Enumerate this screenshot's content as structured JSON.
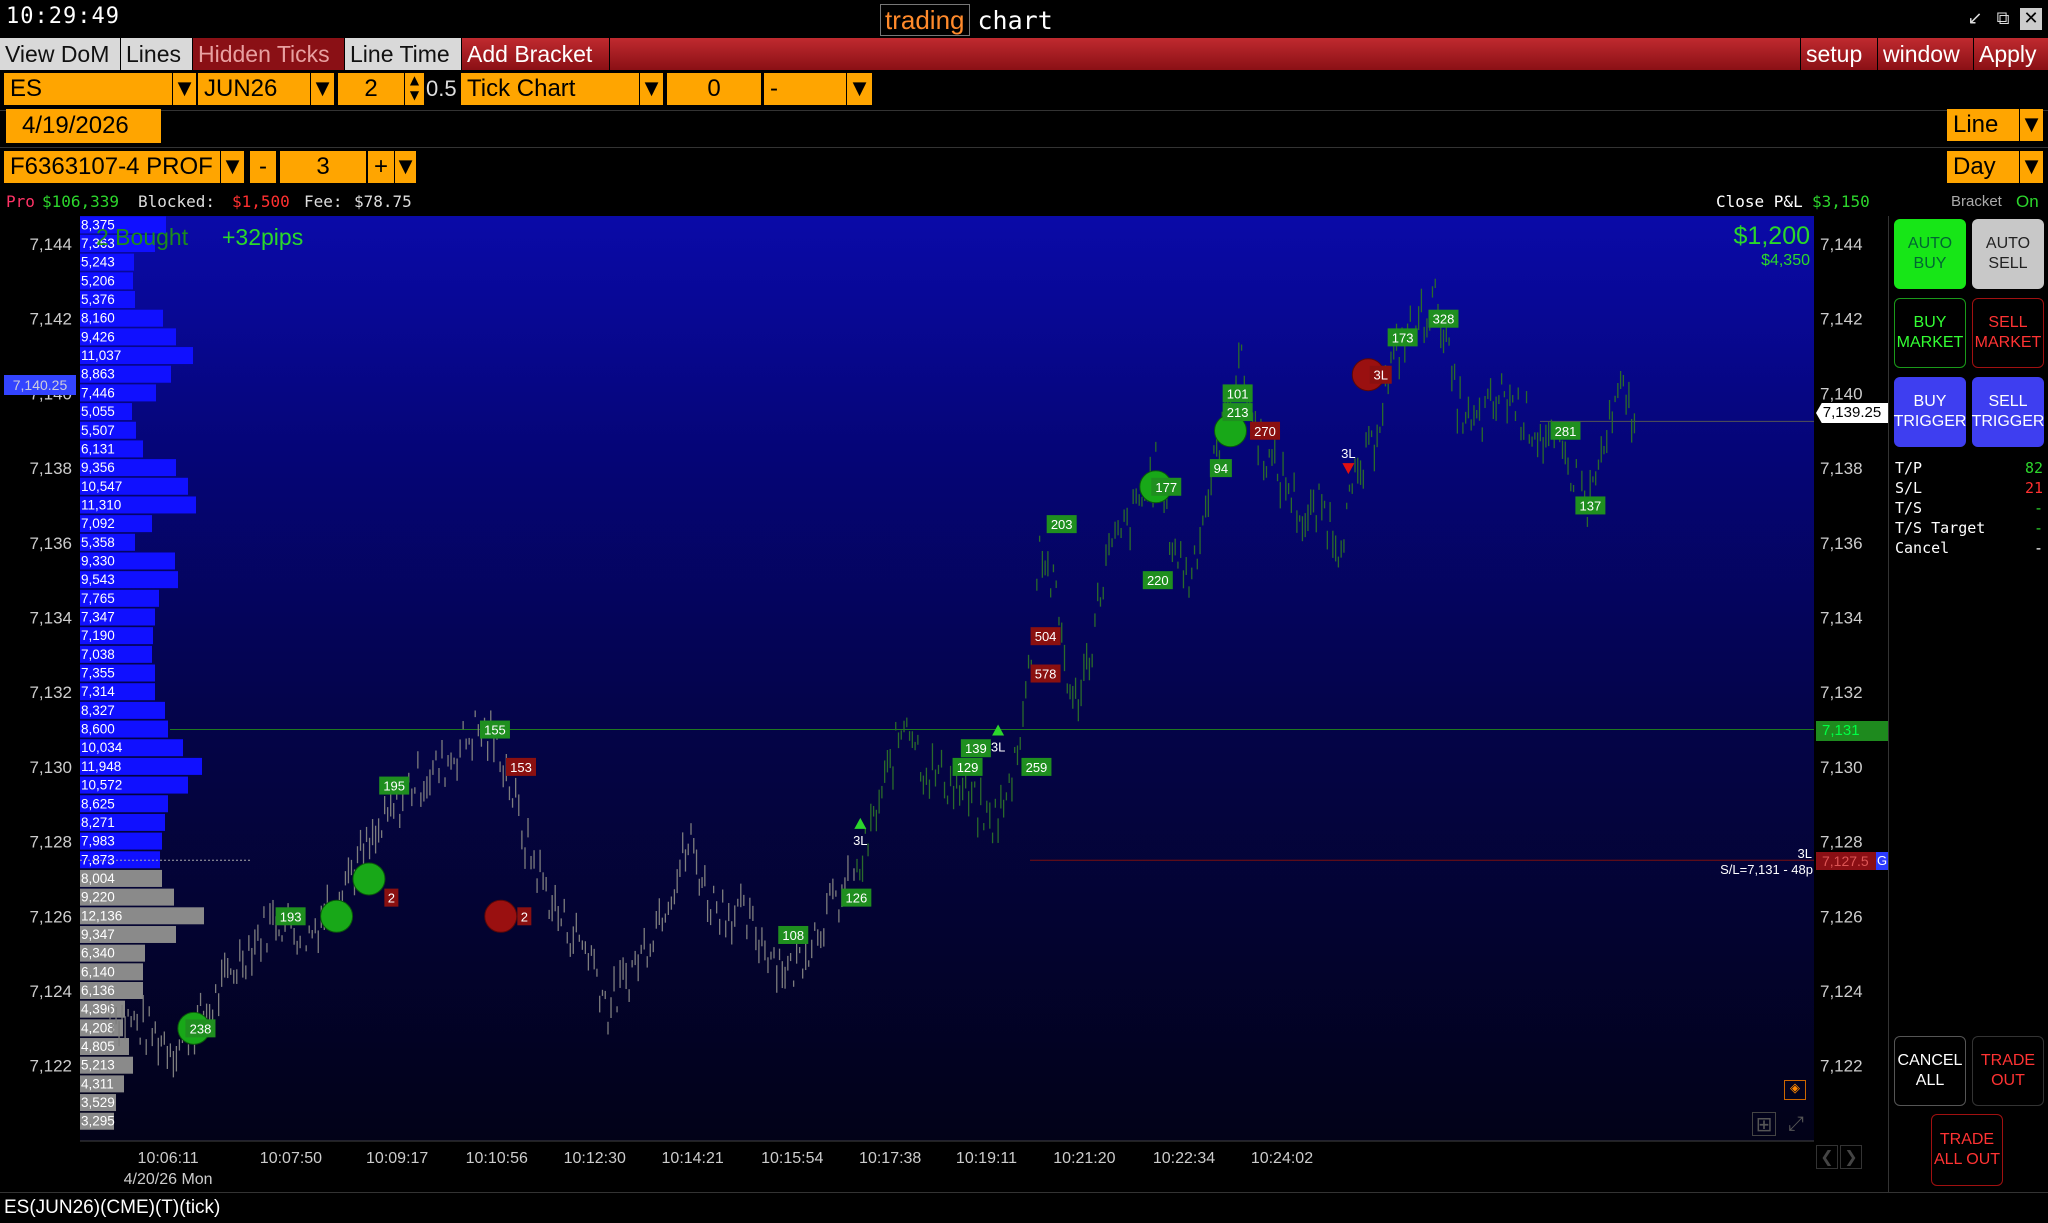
{
  "clock": "10:29:49",
  "title": {
    "app": "trading",
    "name": "chart"
  },
  "toolbar": {
    "view_dom": "View DoM",
    "lines": "Lines",
    "hidden_ticks": "Hidden Ticks",
    "line_time": "Line Time",
    "add_bracket": "Add Bracket",
    "setup": "setup",
    "window": "window",
    "apply": "Apply"
  },
  "controls": {
    "symbol": "ES",
    "month": "JUN26",
    "qty": "2",
    "tick_size": "0.5",
    "chart_type": "Tick Chart",
    "offset": "0",
    "dash": "-",
    "date": "4/19/2026",
    "style": "Line",
    "period": "Day",
    "account": "F6363107-4 PROF",
    "minus": "-",
    "contracts": "3",
    "plus": "+"
  },
  "info": {
    "pro_label": "Pro",
    "pro_value": "$106,339",
    "blocked_label": "Blocked:",
    "blocked_value": "$1,500",
    "fee_label": "Fee:",
    "fee_value": "$78.75",
    "close_pl_label": "Close P&L",
    "close_pl_value": "$3,150",
    "bracket_label": "Bracket",
    "bracket_value": "On"
  },
  "overlay": {
    "position": "2 Bought",
    "pips": "+32pips",
    "pl": "$1,200",
    "pl2": "$4,350",
    "sl_text": "S/L=7,131 - 48p",
    "sl_3l": "3L"
  },
  "price_tags": {
    "current": "7,139.25",
    "target": "7,131",
    "stop": "7,127.5",
    "left_marker": "7,140.25",
    "stop_flag": "G"
  },
  "chart_data": {
    "type": "table",
    "instrument": "ES(JUN26)(CME)(T)(tick)",
    "x_ticks": [
      "10:06:11",
      "10:07:50",
      "10:09:17",
      "10:10:56",
      "10:12:30",
      "10:14:21",
      "10:15:54",
      "10:17:38",
      "10:19:11",
      "10:21:20",
      "10:22:34",
      "10:24:02"
    ],
    "x_date": "4/20/26 Mon",
    "y_ticks": [
      7144,
      7142,
      7140,
      7138,
      7136,
      7134,
      7132,
      7130,
      7128,
      7126,
      7124,
      7122
    ],
    "y_tick_labels": [
      "7,144",
      "7,142",
      "7,140",
      "7,138",
      "7,136",
      "7,134",
      "7,132",
      "7,130",
      "7,128",
      "7,126",
      "7,124",
      "7,122"
    ],
    "ylim": [
      7120.5,
      7145
    ],
    "volume_profile": [
      {
        "price": 7144.5,
        "vol": "8,375"
      },
      {
        "price": 7144,
        "vol": "7,363"
      },
      {
        "price": 7143.5,
        "vol": "5,243"
      },
      {
        "price": 7143,
        "vol": "5,206"
      },
      {
        "price": 7142.5,
        "vol": "5,376"
      },
      {
        "price": 7142,
        "vol": "8,160"
      },
      {
        "price": 7141.5,
        "vol": "9,426"
      },
      {
        "price": 7141,
        "vol": "11,037"
      },
      {
        "price": 7140.5,
        "vol": "8,863"
      },
      {
        "price": 7140,
        "vol": "7,446"
      },
      {
        "price": 7139.5,
        "vol": "5,055"
      },
      {
        "price": 7139,
        "vol": "5,507"
      },
      {
        "price": 7138.5,
        "vol": "6,131"
      },
      {
        "price": 7138,
        "vol": "9,356"
      },
      {
        "price": 7137.5,
        "vol": "10,547"
      },
      {
        "price": 7137,
        "vol": "11,310"
      },
      {
        "price": 7136.5,
        "vol": "7,092"
      },
      {
        "price": 7136,
        "vol": "5,358"
      },
      {
        "price": 7135.5,
        "vol": "9,330"
      },
      {
        "price": 7135,
        "vol": "9,543"
      },
      {
        "price": 7134.5,
        "vol": "7,765"
      },
      {
        "price": 7134,
        "vol": "7,347"
      },
      {
        "price": 7133.5,
        "vol": "7,190"
      },
      {
        "price": 7133,
        "vol": "7,038"
      },
      {
        "price": 7132.5,
        "vol": "7,355"
      },
      {
        "price": 7132,
        "vol": "7,314"
      },
      {
        "price": 7131.5,
        "vol": "8,327"
      },
      {
        "price": 7131,
        "vol": "8,600"
      },
      {
        "price": 7130.5,
        "vol": "10,034"
      },
      {
        "price": 7130,
        "vol": "11,948"
      },
      {
        "price": 7129.5,
        "vol": "10,572"
      },
      {
        "price": 7129,
        "vol": "8,625"
      },
      {
        "price": 7128.5,
        "vol": "8,271"
      },
      {
        "price": 7128,
        "vol": "7,983"
      },
      {
        "price": 7127.5,
        "vol": "7,873"
      },
      {
        "price": 7127,
        "vol": "8,004"
      },
      {
        "price": 7126.5,
        "vol": "9,220"
      },
      {
        "price": 7126,
        "vol": "12,136"
      },
      {
        "price": 7125.5,
        "vol": "9,347"
      },
      {
        "price": 7125,
        "vol": "6,340"
      },
      {
        "price": 7124.5,
        "vol": "6,140"
      },
      {
        "price": 7124,
        "vol": "6,136"
      },
      {
        "price": 7123.5,
        "vol": "4,396"
      },
      {
        "price": 7123,
        "vol": "4,208"
      },
      {
        "price": 7122.5,
        "vol": "4,805"
      },
      {
        "price": 7122,
        "vol": "5,213"
      },
      {
        "price": 7121.5,
        "vol": "4,311"
      },
      {
        "price": 7121,
        "vol": "3,529"
      },
      {
        "price": 7120.5,
        "vol": "3,295"
      }
    ],
    "trade_labels": [
      {
        "t": 0.0545,
        "price": 7123,
        "text": "238",
        "color": "green"
      },
      {
        "t": 0.1088,
        "price": 7126,
        "text": "193",
        "color": "green"
      },
      {
        "t": 0.1695,
        "price": 7126.5,
        "text": "2",
        "color": "red"
      },
      {
        "t": 0.1712,
        "price": 7129.5,
        "text": "195",
        "color": "green"
      },
      {
        "t": 0.2319,
        "price": 7131,
        "text": "155",
        "color": "green"
      },
      {
        "t": 0.2476,
        "price": 7130,
        "text": "153",
        "color": "red"
      },
      {
        "t": 0.2496,
        "price": 7126,
        "text": "2",
        "color": "red"
      },
      {
        "t": 0.4116,
        "price": 7125.5,
        "text": "108",
        "color": "green"
      },
      {
        "t": 0.4496,
        "price": 7126.5,
        "text": "126",
        "color": "green"
      },
      {
        "t": 0.5166,
        "price": 7130,
        "text": "129",
        "color": "green"
      },
      {
        "t": 0.5216,
        "price": 7130.5,
        "text": "139",
        "color": "green"
      },
      {
        "t": 0.5581,
        "price": 7130,
        "text": "259",
        "color": "green"
      },
      {
        "t": 0.5636,
        "price": 7132.5,
        "text": "578",
        "color": "red"
      },
      {
        "t": 0.5636,
        "price": 7133.5,
        "text": "504",
        "color": "red"
      },
      {
        "t": 0.5733,
        "price": 7136.5,
        "text": "203",
        "color": "green"
      },
      {
        "t": 0.6312,
        "price": 7135,
        "text": "220",
        "color": "green"
      },
      {
        "t": 0.6363,
        "price": 7137.5,
        "text": "177",
        "color": "green"
      },
      {
        "t": 0.6692,
        "price": 7138,
        "text": "94",
        "color": "green"
      },
      {
        "t": 0.6793,
        "price": 7140,
        "text": "101",
        "color": "green"
      },
      {
        "t": 0.6793,
        "price": 7139.5,
        "text": "213",
        "color": "green"
      },
      {
        "t": 0.6958,
        "price": 7139,
        "text": "270",
        "color": "red"
      },
      {
        "t": 0.7655,
        "price": 7140.5,
        "text": "3L",
        "color": "red"
      },
      {
        "t": 0.7787,
        "price": 7141.5,
        "text": "173",
        "color": "green"
      },
      {
        "t": 0.8033,
        "price": 7142,
        "text": "328",
        "color": "green"
      },
      {
        "t": 0.8768,
        "price": 7139,
        "text": "281",
        "color": "green"
      },
      {
        "t": 0.8918,
        "price": 7137,
        "text": "137",
        "color": "green"
      }
    ],
    "entry_markers": [
      {
        "t": 0.0505,
        "price": 7123,
        "side": "buy"
      },
      {
        "t": 0.1365,
        "price": 7126,
        "side": "buy"
      },
      {
        "t": 0.156,
        "price": 7127,
        "side": "buy"
      },
      {
        "t": 0.2354,
        "price": 7126,
        "side": "sell"
      },
      {
        "t": 0.63,
        "price": 7137.5,
        "side": "buy"
      },
      {
        "t": 0.675,
        "price": 7139,
        "side": "buy"
      },
      {
        "t": 0.758,
        "price": 7140.5,
        "side": "sell"
      }
    ],
    "signal_arrows": [
      {
        "t": 0.452,
        "price": 7128.5,
        "dir": "up",
        "label": "3L"
      },
      {
        "t": 0.535,
        "price": 7131,
        "dir": "up",
        "label": "3L"
      },
      {
        "t": 0.746,
        "price": 7138,
        "dir": "down",
        "label": "3L"
      }
    ],
    "price_path": [
      [
        0.0,
        7123.5
      ],
      [
        0.04,
        7122.5
      ],
      [
        0.06,
        7123.5
      ],
      [
        0.08,
        7125
      ],
      [
        0.1,
        7126
      ],
      [
        0.12,
        7125.5
      ],
      [
        0.14,
        7127
      ],
      [
        0.16,
        7128
      ],
      [
        0.18,
        7129.5
      ],
      [
        0.2,
        7130
      ],
      [
        0.22,
        7131
      ],
      [
        0.235,
        7130.5
      ],
      [
        0.25,
        7128
      ],
      [
        0.27,
        7126
      ],
      [
        0.29,
        7125
      ],
      [
        0.3,
        7123.5
      ],
      [
        0.32,
        7125
      ],
      [
        0.34,
        7127
      ],
      [
        0.35,
        7128
      ],
      [
        0.36,
        7126.5
      ],
      [
        0.38,
        7126
      ],
      [
        0.4,
        7125
      ],
      [
        0.41,
        7124.5
      ],
      [
        0.43,
        7126
      ],
      [
        0.45,
        7127
      ],
      [
        0.46,
        7128.5
      ],
      [
        0.47,
        7130
      ],
      [
        0.48,
        7131.5
      ],
      [
        0.49,
        7130
      ],
      [
        0.51,
        7129.5
      ],
      [
        0.53,
        7128.5
      ],
      [
        0.54,
        7129
      ],
      [
        0.55,
        7131.5
      ],
      [
        0.555,
        7133
      ],
      [
        0.56,
        7136
      ],
      [
        0.57,
        7134.5
      ],
      [
        0.58,
        7131.5
      ],
      [
        0.59,
        7133
      ],
      [
        0.6,
        7135.5
      ],
      [
        0.62,
        7137
      ],
      [
        0.63,
        7138
      ],
      [
        0.64,
        7136
      ],
      [
        0.65,
        7135
      ],
      [
        0.66,
        7137
      ],
      [
        0.67,
        7139
      ],
      [
        0.68,
        7141
      ],
      [
        0.69,
        7139
      ],
      [
        0.7,
        7138
      ],
      [
        0.71,
        7137.5
      ],
      [
        0.72,
        7136.5
      ],
      [
        0.73,
        7137
      ],
      [
        0.74,
        7136
      ],
      [
        0.75,
        7137.5
      ],
      [
        0.76,
        7138.5
      ],
      [
        0.77,
        7140.5
      ],
      [
        0.78,
        7141.5
      ],
      [
        0.79,
        7142
      ],
      [
        0.8,
        7142.5
      ],
      [
        0.81,
        7140
      ],
      [
        0.82,
        7139
      ],
      [
        0.83,
        7139.5
      ],
      [
        0.84,
        7140
      ],
      [
        0.85,
        7139.5
      ],
      [
        0.86,
        7139
      ],
      [
        0.87,
        7138.5
      ],
      [
        0.88,
        7138
      ],
      [
        0.89,
        7137
      ],
      [
        0.9,
        7138.5
      ],
      [
        0.91,
        7140
      ],
      [
        0.92,
        7139.25
      ]
    ],
    "x_tick_t": [
      0.035,
      0.109,
      0.173,
      0.233,
      0.292,
      0.351,
      0.411,
      0.47,
      0.528,
      0.587,
      0.647,
      0.706
    ]
  },
  "side_panel": {
    "auto_buy": "AUTO BUY",
    "auto_sell": "AUTO SELL",
    "buy_market": "BUY MARKET",
    "sell_market": "SELL MARKET",
    "buy_trigger": "BUY TRIGGER",
    "sell_trigger": "SELL TRIGGER",
    "tp_label": "T/P",
    "tp_value": "82",
    "sl_label": "S/L",
    "sl_value": "21",
    "ts_label": "T/S",
    "ts_value": "-",
    "ts_target_label": "T/S Target",
    "ts_target_value": "-",
    "cancel_label": "Cancel",
    "cancel_value": "-",
    "cancel_all": "CANCEL ALL",
    "trade_out": "TRADE OUT",
    "trade_all_out": "TRADE ALL OUT"
  },
  "colors": {
    "accent": "#ffa500",
    "buy": "#19c219",
    "sell": "#b01010",
    "background": "#000000"
  }
}
